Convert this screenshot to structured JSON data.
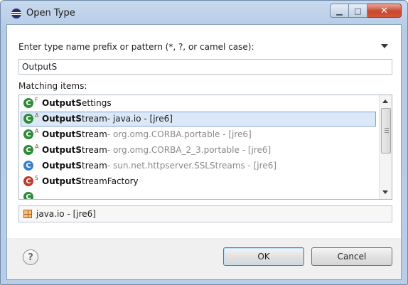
{
  "window": {
    "title": "Open Type"
  },
  "prompt": {
    "label": "Enter type name prefix or pattern (*, ?, or camel case):"
  },
  "search": {
    "value": "OutputS"
  },
  "matching": {
    "label": "Matching items:"
  },
  "items": [
    {
      "icon": "class-final-icon",
      "modifier": "F",
      "bold": "OutputS",
      "rest": "ettings",
      "package": ""
    },
    {
      "icon": "class-abstract-icon",
      "modifier": "A",
      "bold": "OutputS",
      "rest": "tream",
      "package": " - java.io - [jre6]"
    },
    {
      "icon": "class-abstract-icon",
      "modifier": "A",
      "bold": "OutputS",
      "rest": "tream",
      "package": " - org.omg.CORBA.portable - [jre6]"
    },
    {
      "icon": "class-abstract-icon",
      "modifier": "A",
      "bold": "OutputS",
      "rest": "tream",
      "package": " - org.omg.CORBA_2_3.portable - [jre6]"
    },
    {
      "icon": "class-icon",
      "modifier": "",
      "bold": "OutputS",
      "rest": "tream",
      "package": " - sun.net.httpserver.SSLStreams - [jre6]"
    },
    {
      "icon": "class-static-icon",
      "modifier": "S",
      "bold": "OutputS",
      "rest": "treamFactory",
      "package": ""
    }
  ],
  "status": {
    "text": "java.io - [jre6]"
  },
  "buttons": {
    "ok": "OK",
    "cancel": "Cancel",
    "help": "?"
  }
}
